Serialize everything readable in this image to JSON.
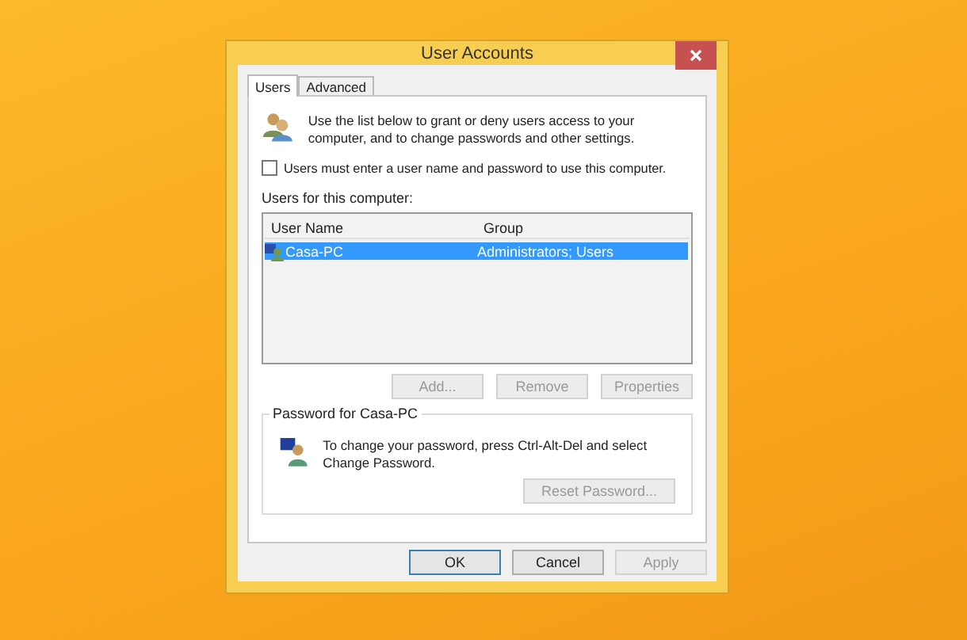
{
  "window": {
    "title": "User Accounts"
  },
  "tabs": [
    {
      "label": "Users",
      "selected": true
    },
    {
      "label": "Advanced",
      "selected": false
    }
  ],
  "intro": "Use the list below to grant or deny users access to your computer, and to change passwords and other settings.",
  "require_login": {
    "label": "Users must enter a user name and password to use this computer.",
    "checked": false
  },
  "users_label": "Users for this computer:",
  "table": {
    "columns": [
      "User Name",
      "Group"
    ],
    "rows": [
      {
        "cells": [
          "Casa-PC",
          "Administrators; Users"
        ],
        "selected": true
      }
    ]
  },
  "list_buttons": [
    {
      "label": "Add...",
      "disabled": true
    },
    {
      "label": "Remove",
      "disabled": true
    },
    {
      "label": "Properties",
      "disabled": true
    }
  ],
  "password_group": {
    "title": "Password for Casa-PC",
    "text": "To change your password, press Ctrl-Alt-Del and select Change Password.",
    "button": {
      "label": "Reset Password...",
      "disabled": true
    }
  },
  "footer_buttons": [
    {
      "label": "OK",
      "disabled": false,
      "default": true
    },
    {
      "label": "Cancel",
      "disabled": false,
      "default": false
    },
    {
      "label": "Apply",
      "disabled": true,
      "default": false
    }
  ]
}
